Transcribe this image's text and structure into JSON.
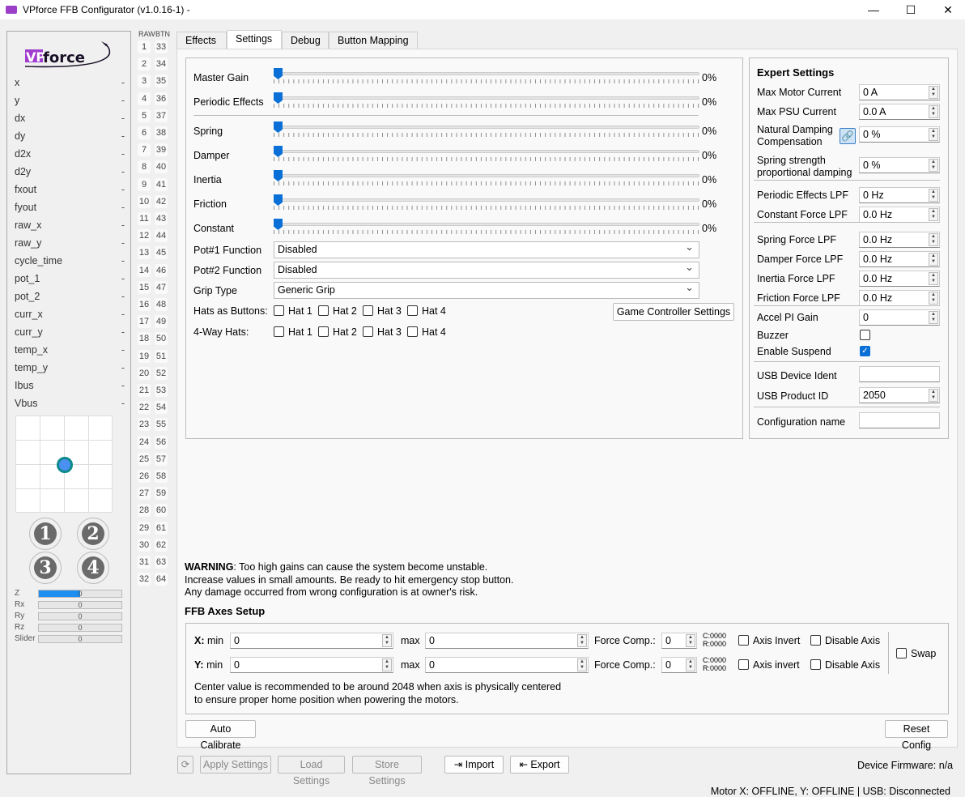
{
  "window": {
    "title": "VPforce FFB Configurator (v1.0.16-1) -",
    "minimize": "—",
    "maximize": "☐",
    "close": "✕"
  },
  "left": {
    "logo": "VPforce",
    "stats": [
      {
        "k": "x",
        "v": "-"
      },
      {
        "k": "y",
        "v": "-"
      },
      {
        "k": "dx",
        "v": "-"
      },
      {
        "k": "dy",
        "v": "-"
      },
      {
        "k": "d2x",
        "v": "-"
      },
      {
        "k": "d2y",
        "v": "-"
      },
      {
        "k": "fxout",
        "v": "-"
      },
      {
        "k": "fyout",
        "v": "-"
      },
      {
        "k": "raw_x",
        "v": "-"
      },
      {
        "k": "raw_y",
        "v": "-"
      },
      {
        "k": "cycle_time",
        "v": "-"
      },
      {
        "k": "pot_1",
        "v": "-"
      },
      {
        "k": "pot_2",
        "v": "-"
      },
      {
        "k": "curr_x",
        "v": "-"
      },
      {
        "k": "curr_y",
        "v": "-"
      },
      {
        "k": "temp_x",
        "v": "-"
      },
      {
        "k": "temp_y",
        "v": "-"
      },
      {
        "k": "Ibus",
        "v": "-"
      },
      {
        "k": "Vbus",
        "v": "-"
      }
    ],
    "hats": [
      "1",
      "2",
      "3",
      "4"
    ],
    "axes": [
      {
        "k": "Z",
        "v": "0",
        "fill": 0.5
      },
      {
        "k": "Rx",
        "v": "0",
        "fill": 0
      },
      {
        "k": "Ry",
        "v": "0",
        "fill": 0
      },
      {
        "k": "Rz",
        "v": "0",
        "fill": 0
      },
      {
        "k": "Slider",
        "v": "0",
        "fill": 0
      }
    ]
  },
  "buttons": {
    "raw_label": "RAW",
    "btn_label": "BTN"
  },
  "tabs": [
    "Effects",
    "Settings",
    "Debug",
    "Button Mapping"
  ],
  "active_tab": 1,
  "sliders": [
    {
      "label": "Master Gain",
      "value": "0%"
    },
    {
      "label": "Periodic Effects",
      "value": "0%"
    },
    {
      "label": "Spring",
      "value": "0%"
    },
    {
      "label": "Damper",
      "value": "0%"
    },
    {
      "label": "Inertia",
      "value": "0%"
    },
    {
      "label": "Friction",
      "value": "0%"
    },
    {
      "label": "Constant",
      "value": "0%"
    }
  ],
  "selects": [
    {
      "label": "Pot#1 Function",
      "value": "Disabled"
    },
    {
      "label": "Pot#2 Function",
      "value": "Disabled"
    },
    {
      "label": "Grip Type",
      "value": "Generic Grip"
    }
  ],
  "hats_as_buttons": {
    "label": "Hats as Buttons:",
    "items": [
      "Hat 1",
      "Hat 2",
      "Hat 3",
      "Hat 4"
    ]
  },
  "four_way_hats": {
    "label": "4-Way Hats:",
    "items": [
      "Hat 1",
      "Hat 2",
      "Hat 3",
      "Hat 4"
    ]
  },
  "game_controller_button": "Game Controller Settings",
  "expert": {
    "title": "Expert Settings",
    "rows": [
      {
        "label": "Max Motor Current",
        "value": "0 A"
      },
      {
        "label": "Max PSU Current",
        "value": "0.0 A"
      },
      {
        "label": "Natural Damping\nCompensation",
        "value": "0 %"
      },
      {
        "label": "Spring strength\nproportional damping",
        "value": "0 %"
      },
      {
        "label": "Periodic Effects LPF",
        "value": "0 Hz"
      },
      {
        "label": "Constant Force LPF",
        "value": "0.0 Hz"
      },
      {
        "label": "Spring Force LPF",
        "value": "0.0 Hz"
      },
      {
        "label": "Damper Force LPF",
        "value": "0.0 Hz"
      },
      {
        "label": "Inertia Force LPF",
        "value": "0.0 Hz"
      },
      {
        "label": "Friction Force LPF",
        "value": "0.0 Hz"
      },
      {
        "label": "Accel PI Gain",
        "value": "0"
      }
    ],
    "buzzer": "Buzzer",
    "enable_suspend": "Enable Suspend",
    "usb_ident": "USB Device Ident",
    "usb_ident_value": "",
    "usb_pid": "USB Product ID",
    "usb_pid_value": "2050",
    "config_name": "Configuration name",
    "config_name_value": ""
  },
  "warning": {
    "bold": "WARNING",
    "line1": ": Too high gains can cause the system become unstable.",
    "line2": "Increase values in small amounts. Be ready to hit emergency stop button.",
    "line3": "Any damage occurred from wrong configuration is at owner's risk."
  },
  "axes_setup": {
    "title": "FFB Axes Setup",
    "rows": [
      {
        "axis": "X:",
        "min_label": "min",
        "min": "0",
        "max_label": "max",
        "max": "0",
        "fc_label": "Force Comp.:",
        "fc": "0",
        "c": "C:0000",
        "r": "R:0000",
        "invert": "Axis Invert",
        "disable": "Disable Axis"
      },
      {
        "axis": "Y:",
        "min_label": "min",
        "min": "0",
        "max_label": "max",
        "max": "0",
        "fc_label": "Force Comp.:",
        "fc": "0",
        "c": "C:0000",
        "r": "R:0000",
        "invert": "Axis invert",
        "disable": "Disable Axis"
      }
    ],
    "swap": "Swap",
    "note1": "Center value is recommended to be around 2048 when axis is physically centered",
    "note2": "to ensure proper home position when powering the motors."
  },
  "auto_calibrate": "Auto Calibrate",
  "reset_config": "Reset Config",
  "bottom": {
    "refresh": "⟳",
    "apply": "Apply Settings",
    "load": "Load Settings",
    "store": "Store Settings",
    "import": "Import",
    "export": "Export",
    "firmware": "Device Firmware:  n/a"
  },
  "status": "Motor X: OFFLINE, Y: OFFLINE | USB: Disconnected"
}
